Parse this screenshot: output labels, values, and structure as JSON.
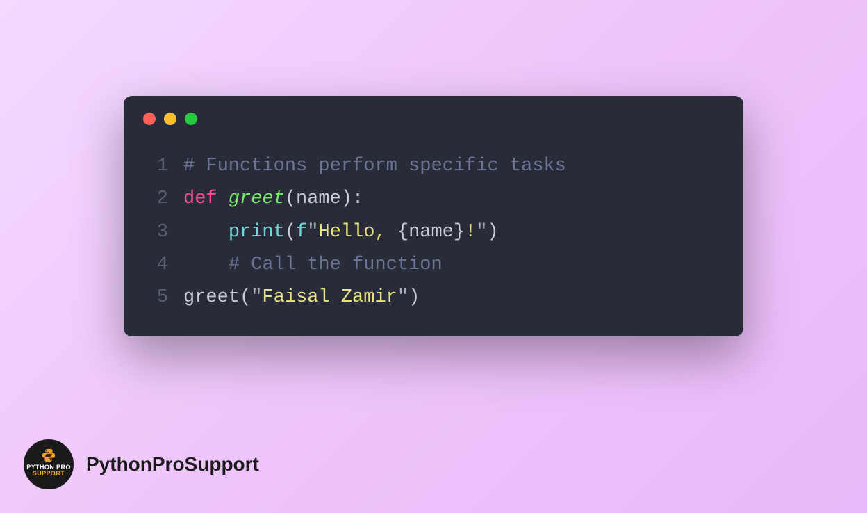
{
  "code": {
    "lines": [
      {
        "num": "1",
        "tokens": [
          {
            "cls": "tok-comment",
            "t": "# Functions perform specific tasks"
          }
        ]
      },
      {
        "num": "2",
        "tokens": [
          {
            "cls": "tok-keyword",
            "t": "def"
          },
          {
            "cls": "tok-default",
            "t": " "
          },
          {
            "cls": "tok-funcdef",
            "t": "greet"
          },
          {
            "cls": "tok-punc",
            "t": "("
          },
          {
            "cls": "tok-param",
            "t": "name"
          },
          {
            "cls": "tok-punc",
            "t": "):"
          }
        ]
      },
      {
        "num": "3",
        "tokens": [
          {
            "cls": "tok-default",
            "t": "    "
          },
          {
            "cls": "tok-builtin",
            "t": "print"
          },
          {
            "cls": "tok-punc",
            "t": "("
          },
          {
            "cls": "tok-fprefix",
            "t": "f"
          },
          {
            "cls": "tok-strquote",
            "t": "\""
          },
          {
            "cls": "tok-string",
            "t": "Hello, "
          },
          {
            "cls": "tok-brace",
            "t": "{"
          },
          {
            "cls": "tok-var",
            "t": "name"
          },
          {
            "cls": "tok-brace",
            "t": "}"
          },
          {
            "cls": "tok-string",
            "t": "!"
          },
          {
            "cls": "tok-strquote",
            "t": "\""
          },
          {
            "cls": "tok-punc",
            "t": ")"
          }
        ]
      },
      {
        "num": "4",
        "tokens": [
          {
            "cls": "tok-default",
            "t": "    "
          },
          {
            "cls": "tok-comment",
            "t": "# Call the function"
          }
        ]
      },
      {
        "num": "5",
        "tokens": [
          {
            "cls": "tok-default",
            "t": "greet("
          },
          {
            "cls": "tok-strquote",
            "t": "\""
          },
          {
            "cls": "tok-string",
            "t": "Faisal Zamir"
          },
          {
            "cls": "tok-strquote",
            "t": "\""
          },
          {
            "cls": "tok-default",
            "t": ")"
          }
        ]
      }
    ]
  },
  "footer": {
    "brand": "PythonProSupport",
    "logo_line1": "PYTHON PRO",
    "logo_line2": "SUPPORT"
  }
}
